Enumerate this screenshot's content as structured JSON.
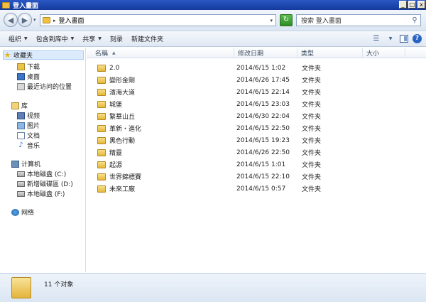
{
  "window": {
    "title": "登入畫面",
    "min": "_",
    "max": "□",
    "close": "x"
  },
  "address": {
    "path": "登入畫面",
    "separator": "▸",
    "search_placeholder": "搜索 登入畫面"
  },
  "toolbar": {
    "organize": "组织",
    "include_in_library": "包含到库中",
    "share": "共享",
    "burn": "刻录",
    "new_folder": "新建文件夹"
  },
  "nav": {
    "favorites": "收藏夹",
    "downloads": "下载",
    "desktop": "桌面",
    "recent": "最近访问的位置",
    "libraries": "库",
    "videos": "视频",
    "pictures": "图片",
    "documents": "文档",
    "music": "音乐",
    "computer": "计算机",
    "drive_c": "本地磁盘 (C:)",
    "drive_d": "新增磁碟區 (D:)",
    "drive_f": "本地磁盘 (F:)",
    "network": "网络"
  },
  "columns": {
    "name": "名稱",
    "date": "修改日期",
    "type": "类型",
    "size": "大小"
  },
  "files": [
    {
      "name": "2.0",
      "date": "2014/6/15 1:02",
      "type": "文件夹"
    },
    {
      "name": "變形金剛",
      "date": "2014/6/26 17:45",
      "type": "文件夹"
    },
    {
      "name": "濱海大道",
      "date": "2014/6/15 22:14",
      "type": "文件夹"
    },
    {
      "name": "城堡",
      "date": "2014/6/15 23:03",
      "type": "文件夹"
    },
    {
      "name": "繁華山丘",
      "date": "2014/6/30 22:04",
      "type": "文件夹"
    },
    {
      "name": "革新・進化",
      "date": "2014/6/15 22:50",
      "type": "文件夹"
    },
    {
      "name": "黑色行動",
      "date": "2014/6/15 19:23",
      "type": "文件夹"
    },
    {
      "name": "精靈",
      "date": "2014/6/26 22:50",
      "type": "文件夹"
    },
    {
      "name": "起源",
      "date": "2014/6/15 1:01",
      "type": "文件夹"
    },
    {
      "name": "世界錦標賽",
      "date": "2014/6/15 22:10",
      "type": "文件夹"
    },
    {
      "name": "未來工廠",
      "date": "2014/6/15 0:57",
      "type": "文件夹"
    }
  ],
  "status": {
    "count_text": "11 个对象"
  }
}
